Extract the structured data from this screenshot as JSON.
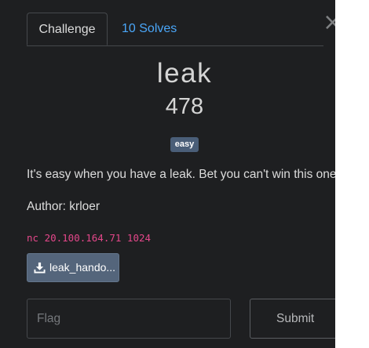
{
  "tabs": {
    "challenge_label": "Challenge",
    "solves_label": "10 Solves"
  },
  "close_glyph": "×",
  "challenge": {
    "name": "leak",
    "points": "478",
    "difficulty_badge": "easy",
    "description": "It's easy when you have a leak. Bet you can't win this one!",
    "author": "Author: krloer",
    "connection": "nc 20.100.164.71 1024",
    "file_label": "leak_hando..."
  },
  "flag_form": {
    "placeholder": "Flag",
    "value": "",
    "submit_label": "Submit"
  },
  "colors": {
    "modal_background": "#1e1f21",
    "link_blue": "#4aa6f8",
    "code_pink": "#e4478a",
    "badge": "#4a5e78",
    "file_button": "#54657b"
  },
  "icons": {
    "close": "close-icon",
    "download": "download-icon"
  }
}
